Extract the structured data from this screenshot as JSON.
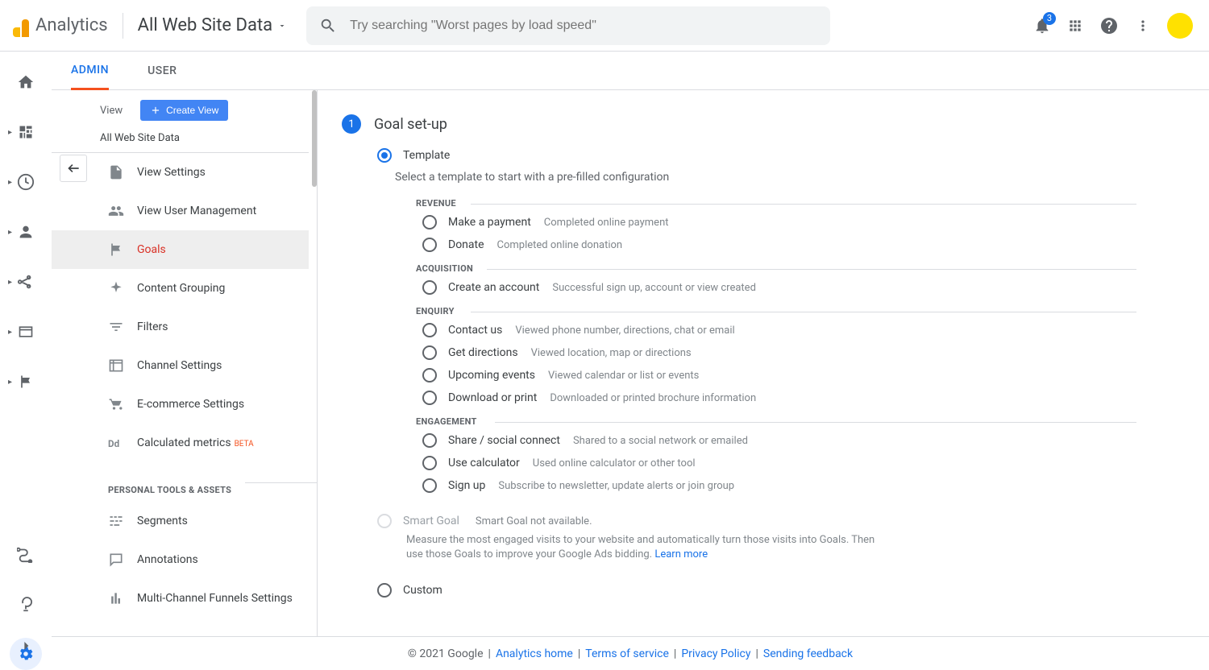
{
  "header": {
    "product": "Analytics",
    "account_selector": "All Web Site Data",
    "search_placeholder": "Try searching \"Worst pages by load speed\"",
    "notification_count": "3"
  },
  "tabs": {
    "admin": "ADMIN",
    "user": "USER"
  },
  "admin_column": {
    "view_label": "View",
    "create_view": "Create View",
    "view_selected": "All Web Site Data",
    "items": [
      {
        "label": "View Settings"
      },
      {
        "label": "View User Management"
      },
      {
        "label": "Goals"
      },
      {
        "label": "Content Grouping"
      },
      {
        "label": "Filters"
      },
      {
        "label": "Channel Settings"
      },
      {
        "label": "E-commerce Settings"
      },
      {
        "label": "Calculated metrics",
        "beta": "BETA"
      }
    ],
    "section": "PERSONAL TOOLS & ASSETS",
    "personal": [
      {
        "label": "Segments"
      },
      {
        "label": "Annotations"
      },
      {
        "label": "Multi-Channel Funnels Settings"
      }
    ]
  },
  "form": {
    "step_num": "1",
    "step_title": "Goal set-up",
    "template_label": "Template",
    "template_help": "Select a template to start with a pre-filled configuration",
    "groups": [
      {
        "title": "REVENUE",
        "cls": "rev",
        "options": [
          {
            "label": "Make a payment",
            "desc": "Completed online payment"
          },
          {
            "label": "Donate",
            "desc": "Completed online donation"
          }
        ]
      },
      {
        "title": "ACQUISITION",
        "cls": "acq",
        "options": [
          {
            "label": "Create an account",
            "desc": "Successful sign up, account or view created"
          }
        ]
      },
      {
        "title": "ENQUIRY",
        "cls": "enq",
        "options": [
          {
            "label": "Contact us",
            "desc": "Viewed phone number, directions, chat or email"
          },
          {
            "label": "Get directions",
            "desc": "Viewed location, map or directions"
          },
          {
            "label": "Upcoming events",
            "desc": "Viewed calendar or list or events"
          },
          {
            "label": "Download or print",
            "desc": "Downloaded or printed brochure information"
          }
        ]
      },
      {
        "title": "ENGAGEMENT",
        "cls": "eng",
        "options": [
          {
            "label": "Share / social connect",
            "desc": "Shared to a social network or emailed"
          },
          {
            "label": "Use calculator",
            "desc": "Used online calculator or other tool"
          },
          {
            "label": "Sign up",
            "desc": "Subscribe to newsletter, update alerts or join group"
          }
        ]
      }
    ],
    "smart_label": "Smart Goal",
    "smart_unavailable": "Smart Goal not available.",
    "smart_help": "Measure the most engaged visits to your website and automatically turn those visits into Goals. Then use those Goals to improve your Google Ads bidding.",
    "learn_more": "Learn more",
    "custom_label": "Custom"
  },
  "footer": {
    "copyright": "© 2021 Google",
    "links": [
      "Analytics home",
      "Terms of service",
      "Privacy Policy",
      "Sending feedback"
    ]
  }
}
